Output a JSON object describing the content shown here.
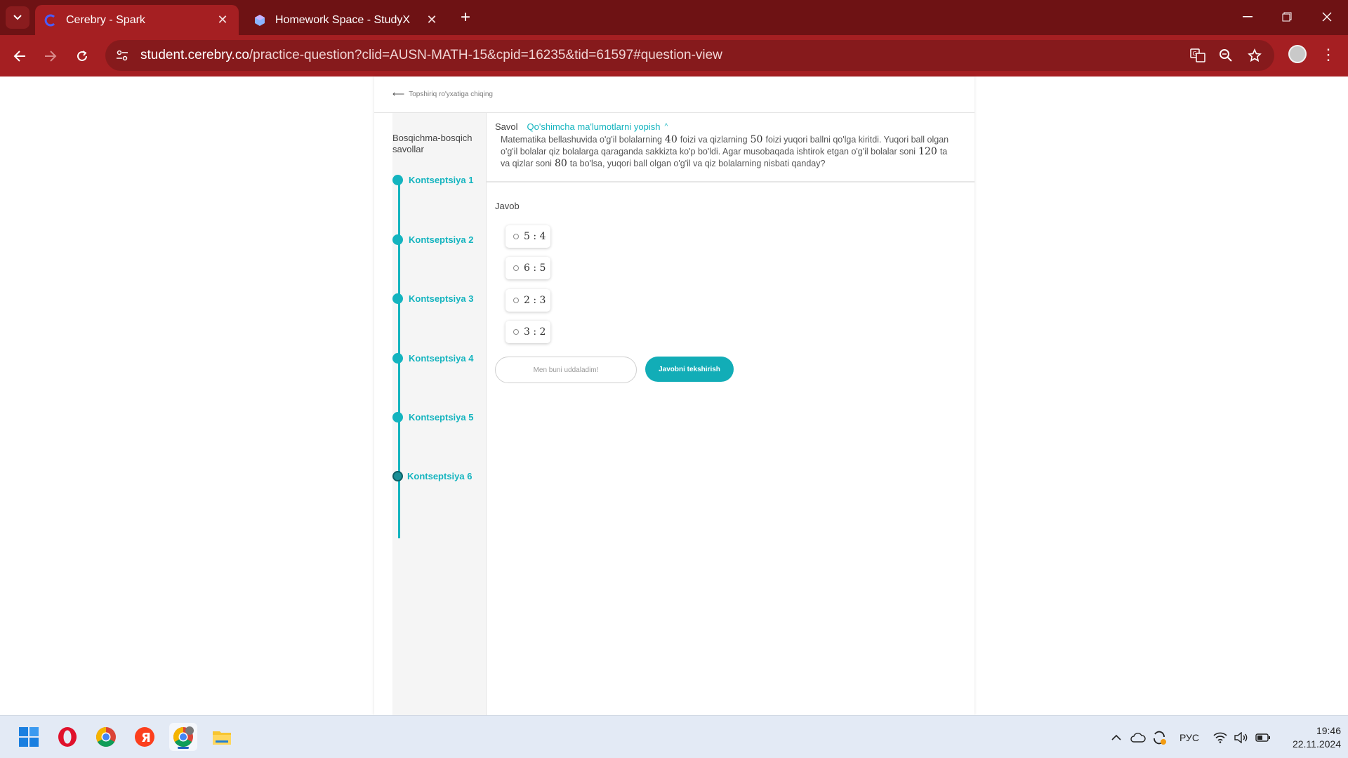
{
  "browser": {
    "tabs": [
      {
        "title": "Cerebry - Spark",
        "active": true,
        "favicon": "cerebry-favicon"
      },
      {
        "title": "Homework Space - StudyX",
        "active": false,
        "favicon": "studyx-favicon"
      }
    ],
    "url_host": "student.cerebry.co",
    "url_path": "/practice-question?clid=AUSN-MATH-15&cpid=16235&tid=61597#question-view",
    "colors": {
      "frame": "#6e1214",
      "toolbar": "#a51f22",
      "omnibox": "#861a1c"
    }
  },
  "page": {
    "back_link": "Topshiriq ro'yxatiga chiqing",
    "sidebar": {
      "title": "Bosqichma-bosqich savollar",
      "steps": [
        "Kontseptsiya 1",
        "Kontseptsiya 2",
        "Kontseptsiya 3",
        "Kontseptsiya 4",
        "Kontseptsiya 5",
        "Kontseptsiya 6"
      ]
    },
    "question": {
      "label": "Savol",
      "toggle": "Qo'shimcha ma'lumotlarni yopish",
      "text_1": "Matematika bellashuvida o'g'il bolalarning",
      "num_1": "40",
      "text_2": "foizi va qizlarning",
      "num_2": "50",
      "text_3": "foizi yuqori ballni qo'lga kiritdi. Yuqori ball olgan o'g'il bolalar qiz bolalarga qaraganda sakkizta ko'p bo'ldi. Agar musobaqada ishtirok etgan o'g'il bolalar soni",
      "num_3": "120",
      "text_4": "ta va qizlar soni",
      "num_4": "80",
      "text_5": "ta bo'lsa, yuqori ball olgan o'g'il va qiz bolalarning nisbati qanday?"
    },
    "answer": {
      "label": "Javob",
      "options": [
        "5 : 4",
        "6 : 5",
        "2 : 3",
        "3 : 2"
      ]
    },
    "buttons": {
      "skip": "Men buni uddaladim!",
      "check": "Javobni tekshirish"
    },
    "accent": "#14b4bf"
  },
  "taskbar": {
    "apps": [
      "windows-start",
      "opera",
      "chrome",
      "yandex-browser",
      "chrome-profile",
      "file-explorer"
    ],
    "language": "РУС",
    "time": "19:46",
    "date": "22.11.2024"
  }
}
